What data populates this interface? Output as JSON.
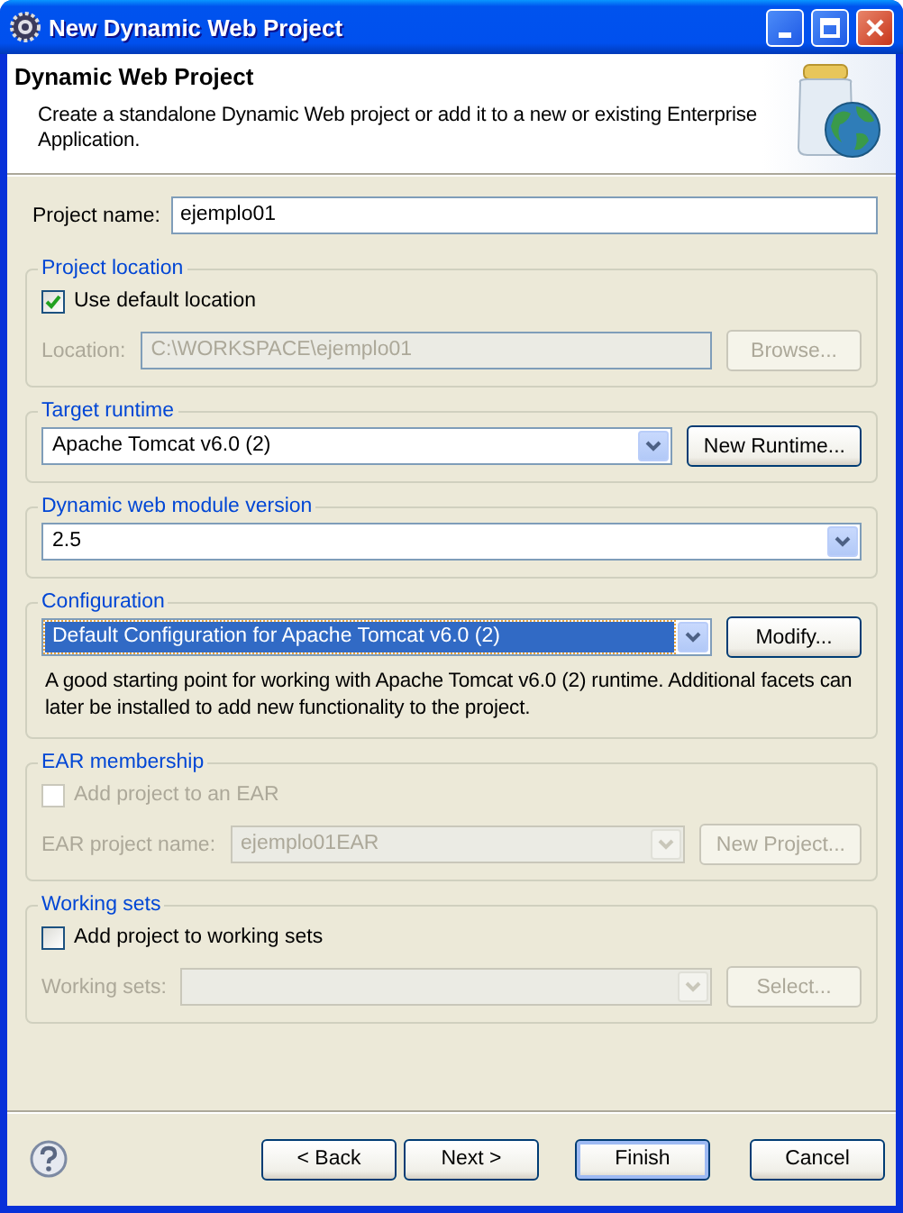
{
  "window": {
    "title": "New Dynamic Web Project"
  },
  "header": {
    "title": "Dynamic Web Project",
    "description": "Create a standalone Dynamic Web project or add it to a new or existing Enterprise Application."
  },
  "project_name": {
    "label": "Project name:",
    "value": "ejemplo01"
  },
  "groups": [
    {
      "title": "Project location",
      "rows": [
        {
          "kind": "checkbox",
          "label": "Use default location",
          "checked": true,
          "disabled": false
        },
        {
          "kind": "field",
          "label": "Location:",
          "value": "C:\\WORKSPACE\\ejemplo01",
          "disabled": true,
          "button": {
            "label": "Browse...",
            "disabled": true
          }
        }
      ]
    },
    {
      "title": "Target runtime",
      "rows": [
        {
          "kind": "combo",
          "value": "Apache Tomcat v6.0 (2)",
          "disabled": false,
          "button": {
            "label": "New Runtime...",
            "disabled": false
          }
        }
      ]
    },
    {
      "title": "Dynamic web module version",
      "rows": [
        {
          "kind": "combo",
          "value": "2.5",
          "disabled": false
        }
      ]
    },
    {
      "title": "Configuration",
      "rows": [
        {
          "kind": "combo",
          "value": "Default Configuration for Apache Tomcat v6.0 (2)",
          "disabled": false,
          "selected": true,
          "button": {
            "label": "Modify...",
            "disabled": false
          }
        },
        {
          "kind": "text",
          "text": "A good starting point for working with Apache Tomcat v6.0 (2) runtime. Additional facets can later be installed to add new functionality to the project."
        }
      ]
    },
    {
      "title": "EAR membership",
      "rows": [
        {
          "kind": "checkbox",
          "label": "Add project to an EAR",
          "checked": false,
          "disabled": true
        },
        {
          "kind": "combo",
          "label": "EAR project name:",
          "value": "ejemplo01EAR",
          "disabled": true,
          "button": {
            "label": "New Project...",
            "disabled": true
          }
        }
      ]
    },
    {
      "title": "Working sets",
      "rows": [
        {
          "kind": "checkbox",
          "label": "Add project to working sets",
          "checked": false,
          "disabled": false
        },
        {
          "kind": "combo",
          "label": "Working sets:",
          "disabled": true,
          "button": {
            "label": "Select...",
            "disabled": true
          }
        }
      ]
    }
  ],
  "buttons": [
    {
      "label": "< Back",
      "default": false,
      "disabled": false
    },
    {
      "label": "Next >",
      "default": false,
      "disabled": false
    },
    {
      "label": "Finish",
      "default": true,
      "disabled": false
    },
    {
      "label": "Cancel",
      "default": false,
      "disabled": false
    }
  ]
}
